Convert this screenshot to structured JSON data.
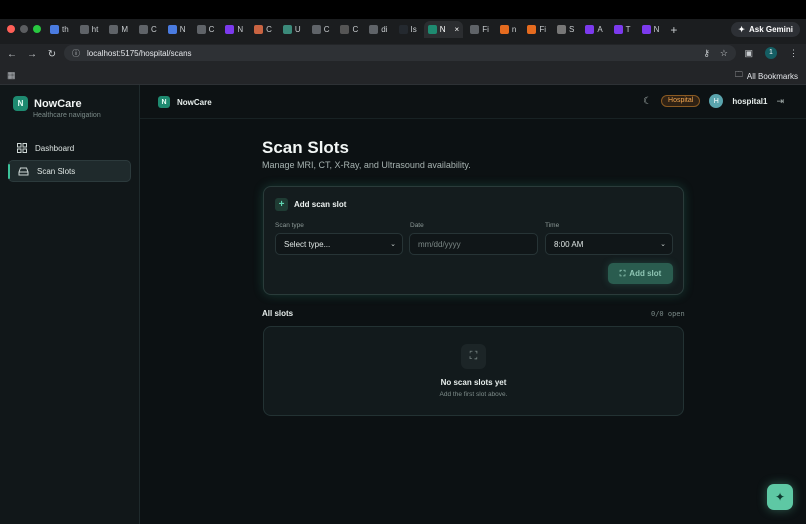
{
  "browser": {
    "tabs": [
      {
        "label": "th",
        "icon": "docs-icon"
      },
      {
        "label": "ht",
        "icon": "google-icon"
      },
      {
        "label": "M",
        "icon": "maps-icon"
      },
      {
        "label": "C",
        "icon": "chatgpt-icon"
      },
      {
        "label": "N",
        "icon": "docs-icon"
      },
      {
        "label": "C",
        "icon": "chatgpt-icon"
      },
      {
        "label": "N",
        "icon": "bolt-icon"
      },
      {
        "label": "C",
        "icon": "claude-icon"
      },
      {
        "label": "U",
        "icon": "perplexity-icon"
      },
      {
        "label": "C",
        "icon": "chatgpt-icon"
      },
      {
        "label": "C",
        "icon": "loading-icon"
      },
      {
        "label": "di",
        "icon": "chatgpt-icon"
      },
      {
        "label": "Is",
        "icon": "github-icon"
      },
      {
        "label": "N",
        "icon": "app-icon",
        "active": true
      },
      {
        "label": "Fi",
        "icon": "globe-icon"
      },
      {
        "label": "n",
        "icon": "fire-icon"
      },
      {
        "label": "Fi",
        "icon": "fire-icon"
      },
      {
        "label": "S",
        "icon": "spark-icon"
      },
      {
        "label": "A",
        "icon": "bolt-icon"
      },
      {
        "label": "T",
        "icon": "bolt-icon"
      },
      {
        "label": "N",
        "icon": "bolt-icon"
      }
    ],
    "ask_gemini": "Ask Gemini",
    "url": "localhost:5175/hospital/scans",
    "profile_initial": "1",
    "all_bookmarks": "All Bookmarks"
  },
  "sidebar": {
    "brand_initial": "N",
    "brand_name": "NowCare",
    "brand_sub": "Healthcare navigation",
    "items": [
      {
        "label": "Dashboard",
        "icon": "grid-icon"
      },
      {
        "label": "Scan Slots",
        "icon": "scanner-icon",
        "active": true
      }
    ]
  },
  "topbar": {
    "brand_initial": "N",
    "brand_name": "NowCare",
    "role_badge": "Hospital",
    "avatar_initial": "H",
    "username": "hospital1"
  },
  "page": {
    "title": "Scan Slots",
    "subtitle": "Manage MRI, CT, X-Ray, and Ultrasound availability."
  },
  "form": {
    "heading": "Add scan slot",
    "scan_type_label": "Scan type",
    "scan_type_value": "Select type...",
    "date_label": "Date",
    "date_placeholder": "mm/dd/yyyy",
    "time_label": "Time",
    "time_value": "8:00 AM",
    "submit_label": "Add slot"
  },
  "slots": {
    "heading": "All slots",
    "count": "0/0 open",
    "empty_title": "No scan slots yet",
    "empty_sub": "Add the first slot above."
  },
  "colors": {
    "accent": "#5ec8a4",
    "badge": "#f0a44e"
  }
}
